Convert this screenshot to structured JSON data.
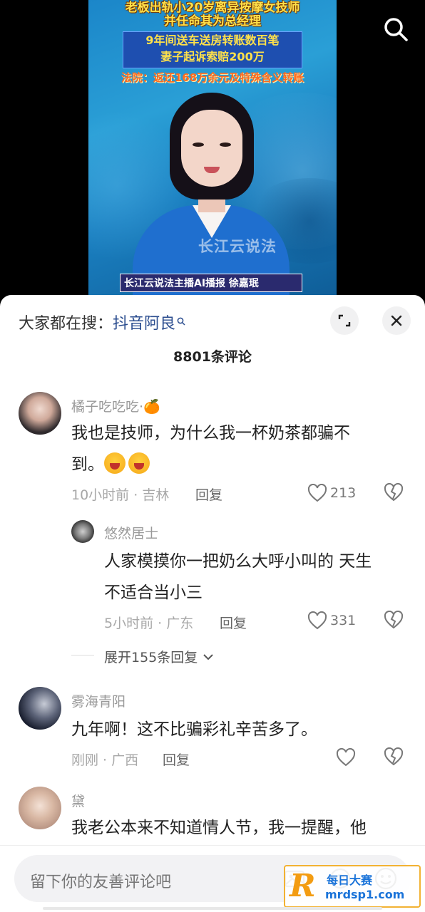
{
  "video": {
    "headline_line1": "老板出轨小20岁离异按摩女技师",
    "headline_line2": "并任命其为总经理",
    "headline_line3": "9年间送车送房转账数百笔",
    "headline_line4": "妻子起诉索赔200万",
    "headline_line5": "法院：返还168万余元及特殊含义转账",
    "watermark_logo": "长江云说法",
    "lower_third": "长江云说法主播AI播报  徐嘉珉",
    "search_icon": "search-icon"
  },
  "panel": {
    "search_prefix": "大家都在搜：",
    "search_term": "抖音阿良",
    "expand_icon": "expand-icon",
    "close_icon": "close-icon",
    "comment_count": "8801条评论"
  },
  "comments": [
    {
      "username": "橘子吃吃吃·🍊",
      "text_line1": "我也是技师，为什么我一杯奶茶都骗不",
      "text_line2": "到。",
      "emoji_count": 2,
      "meta": "10小时前 · 吉林",
      "reply_label": "回复",
      "likes": "213"
    },
    {
      "username": "悠然居士",
      "text_line1": "人家模摸你一把奶么大呼小叫的  天生",
      "text_line2": "不适合当小三",
      "meta": "5小时前 · 广东",
      "reply_label": "回复",
      "likes": "331"
    },
    {
      "username": "雾海青阳",
      "text_line1": "九年啊！这不比骗彩礼辛苦多了。",
      "meta": "刚刚 · 广西",
      "reply_label": "回复",
      "likes": ""
    },
    {
      "username": "黛",
      "text_line1": "我老公本来不知道情人节，我一提醒，他"
    }
  ],
  "expand_replies": "展开155条回复",
  "input": {
    "placeholder": "留下你的友善评论吧",
    "image_icon": "image-icon",
    "at_icon": "at-icon",
    "emoji_icon": "emoji-icon"
  },
  "watermark": {
    "letter": "R",
    "line1": "每日大赛",
    "line2": "mrdsp1.com"
  }
}
